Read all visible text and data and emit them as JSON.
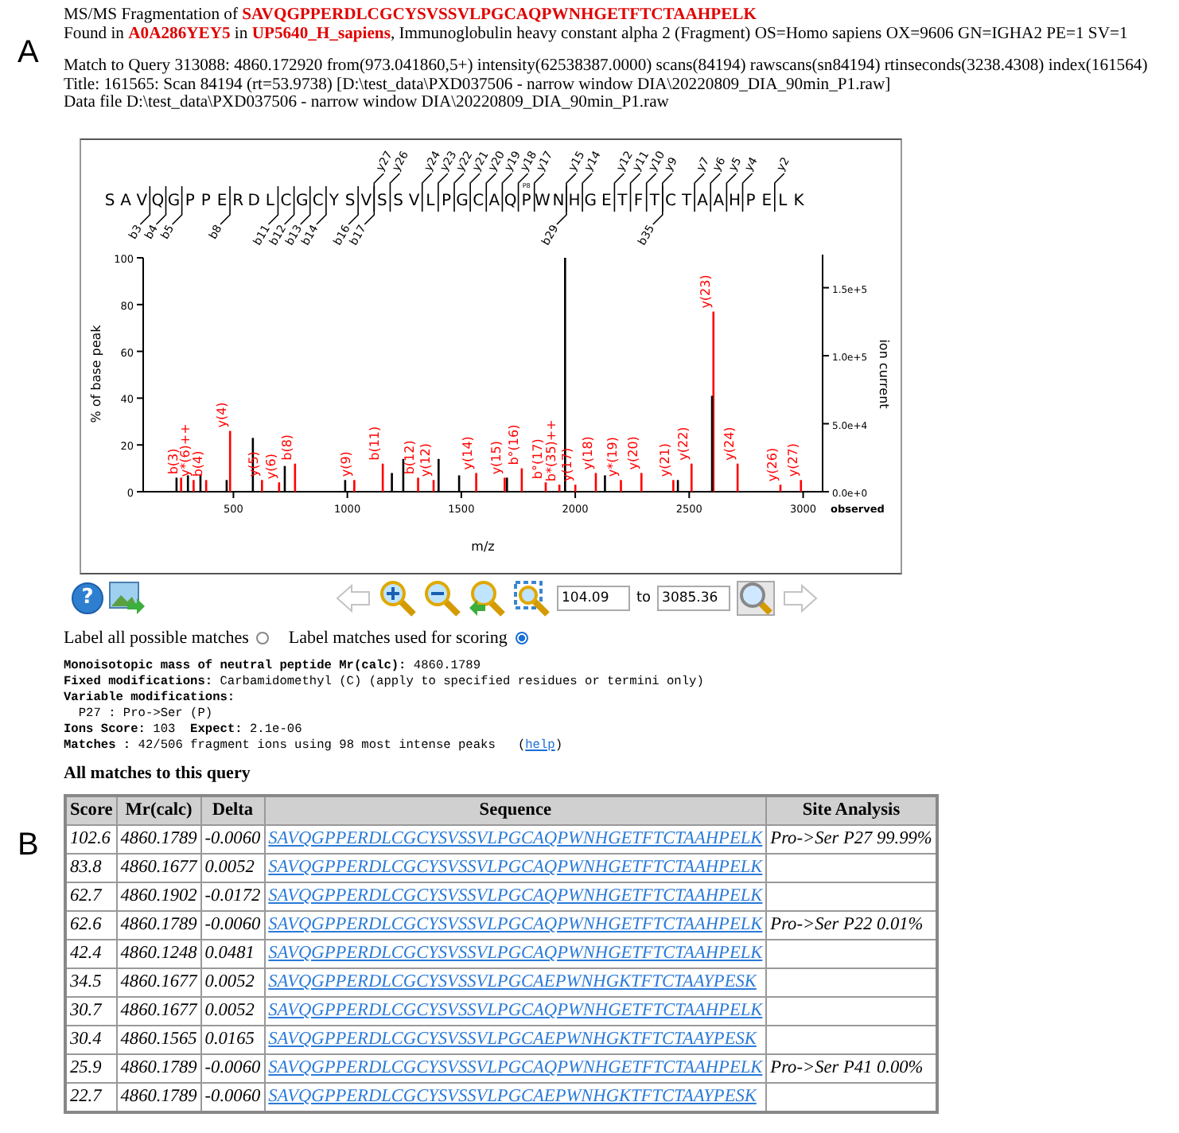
{
  "panels": {
    "top": "A",
    "bottom": "B"
  },
  "title_lines": [
    "MS/MS Fragmentation of **SAVQGPPERDLCGCYSVSSVLPGCAQPWNHGETFTCTAAHPELK**",
    "Found in **A0A286YEY5** in **UP5640_H_sapiens**, Immunoglobulin heavy constant alpha 2 (Fragment) OS=Homo sapiens OX=9606 GN=IGHA2 PE=1 SV=1"
  ],
  "query_lines": [
    "Match to Query 313088: 4860.172920 from(973.041860,5+) intensity(62538387.0000) scans(84194) rawscans(sn84194) rtinseconds(3238.4308) index(161564)",
    "Title: 161565: Scan 84194 (rt=53.9738) [D:\\test_data\\PXD037506 - narrow window DIA\\20220809_DIA_90min_P1.raw]",
    "Data file D:\\test_data\\PXD037506 - narrow window DIA\\20220809_DIA_90min_P1.raw"
  ],
  "ladder": [
    {
      "aa": "S"
    },
    {
      "aa": "A"
    },
    {
      "aa": "V",
      "b": "b3"
    },
    {
      "aa": "Q",
      "b": "b4"
    },
    {
      "aa": "G",
      "b": "b5"
    },
    {
      "aa": "P"
    },
    {
      "aa": "P"
    },
    {
      "aa": "E",
      "b": "b8"
    },
    {
      "aa": "R"
    },
    {
      "aa": "D"
    },
    {
      "aa": "L",
      "b": "b11"
    },
    {
      "aa": "C",
      "b": "b12"
    },
    {
      "aa": "G",
      "b": "b13"
    },
    {
      "aa": "C",
      "b": "b14"
    },
    {
      "aa": "Y"
    },
    {
      "aa": "S",
      "b": "b16"
    },
    {
      "aa": "V",
      "b": "b17",
      "y": "y27"
    },
    {
      "aa": "S",
      "y": "y26"
    },
    {
      "aa": "S"
    },
    {
      "aa": "V",
      "y": "y24"
    },
    {
      "aa": "L",
      "y": "y23"
    },
    {
      "aa": "P",
      "y": "y22"
    },
    {
      "aa": "G",
      "y": "y21"
    },
    {
      "aa": "C",
      "y": "y20"
    },
    {
      "aa": "A",
      "y": "y19"
    },
    {
      "aa": "Q",
      "y": "y18"
    },
    {
      "aa": "P",
      "y": "y17",
      "mod": "P8"
    },
    {
      "aa": "W"
    },
    {
      "aa": "N",
      "b": "b29",
      "y": "y15"
    },
    {
      "aa": "H",
      "y": "y14"
    },
    {
      "aa": "G"
    },
    {
      "aa": "E",
      "y": "y12"
    },
    {
      "aa": "T",
      "y": "y11"
    },
    {
      "aa": "F",
      "y": "y10"
    },
    {
      "aa": "T",
      "b": "b35",
      "y": "y9"
    },
    {
      "aa": "C"
    },
    {
      "aa": "T",
      "y": "y7"
    },
    {
      "aa": "A",
      "y": "y6"
    },
    {
      "aa": "A",
      "y": "y5"
    },
    {
      "aa": "H",
      "y": "y4"
    },
    {
      "aa": "P"
    },
    {
      "aa": "E",
      "y": "y2"
    },
    {
      "aa": "L"
    },
    {
      "aa": "K"
    }
  ],
  "chart_data": {
    "type": "bar",
    "xlabel": "m/z",
    "ylabel": "% of base peak",
    "xlim": [
      104.09,
      3085.36
    ],
    "ylim": [
      0,
      100
    ],
    "xticks": [
      500,
      1000,
      1500,
      2000,
      2500,
      3000
    ],
    "yticks": [
      0,
      20,
      40,
      60,
      80,
      100
    ],
    "y2label": "ion current",
    "y2lim": [
      0,
      172000
    ],
    "y2ticks": [
      {
        "value": 0,
        "label": "0.0e+0"
      },
      {
        "value": 50000,
        "label": "5.0e+4"
      },
      {
        "value": 100000,
        "label": "1.0e+5"
      },
      {
        "value": 150000,
        "label": "1.5e+5"
      }
    ],
    "x": [
      250,
      270,
      300,
      325,
      355,
      380,
      470,
      485,
      585,
      625,
      700,
      725,
      770,
      990,
      1030,
      1155,
      1195,
      1245,
      1310,
      1378,
      1400,
      1490,
      1565,
      1690,
      1700,
      1765,
      1870,
      1930,
      1955,
      2000,
      2090,
      2130,
      2200,
      2290,
      2430,
      2450,
      2510,
      2600,
      2606,
      2712,
      2900,
      2990
    ],
    "series": [
      {
        "color": "#ff0000",
        "values": [
          null,
          6,
          null,
          5,
          null,
          5,
          null,
          26,
          null,
          5,
          4,
          null,
          12,
          null,
          5,
          12,
          null,
          null,
          6,
          5,
          null,
          null,
          8,
          6,
          null,
          10,
          4,
          3,
          null,
          3,
          8,
          null,
          5,
          8,
          5,
          null,
          12,
          null,
          77,
          12,
          3,
          5
        ]
      },
      {
        "color": "#000000",
        "values": [
          6,
          null,
          7,
          null,
          7,
          null,
          5,
          null,
          23,
          null,
          null,
          11,
          null,
          5,
          null,
          null,
          8,
          14,
          null,
          null,
          14,
          7,
          null,
          null,
          6,
          null,
          null,
          null,
          100,
          null,
          null,
          7,
          null,
          null,
          null,
          5,
          null,
          41,
          null,
          null,
          null,
          null
        ]
      }
    ],
    "annotations": [
      {
        "x": 270,
        "y": 6,
        "text": "b(3)"
      },
      {
        "x": 325,
        "y": 5,
        "text": "y*(6)++"
      },
      {
        "x": 380,
        "y": 5,
        "text": "b(4)"
      },
      {
        "x": 485,
        "y": 26,
        "text": "y(4)"
      },
      {
        "x": 625,
        "y": 5,
        "text": "y(5)"
      },
      {
        "x": 700,
        "y": 4,
        "text": "y(6)"
      },
      {
        "x": 770,
        "y": 12,
        "text": "b(8)"
      },
      {
        "x": 1030,
        "y": 5,
        "text": "y(9)"
      },
      {
        "x": 1155,
        "y": 12,
        "text": "b(11)"
      },
      {
        "x": 1310,
        "y": 6,
        "text": "b(12)"
      },
      {
        "x": 1378,
        "y": 5,
        "text": "y(12)"
      },
      {
        "x": 1565,
        "y": 8,
        "text": "y(14)"
      },
      {
        "x": 1690,
        "y": 6,
        "text": "y(15)"
      },
      {
        "x": 1765,
        "y": 10,
        "text": "b°(16)"
      },
      {
        "x": 1870,
        "y": 4,
        "text": "b°(17)"
      },
      {
        "x": 1930,
        "y": 3,
        "text": "b*(35)++"
      },
      {
        "x": 2000,
        "y": 3,
        "text": "y(17)"
      },
      {
        "x": 2090,
        "y": 8,
        "text": "y(18)"
      },
      {
        "x": 2200,
        "y": 5,
        "text": "y*(19)"
      },
      {
        "x": 2290,
        "y": 8,
        "text": "y(20)"
      },
      {
        "x": 2430,
        "y": 5,
        "text": "y(21)"
      },
      {
        "x": 2510,
        "y": 12,
        "text": "y(22)"
      },
      {
        "x": 2606,
        "y": 77,
        "text": "y(23)"
      },
      {
        "x": 2712,
        "y": 12,
        "text": "y(24)"
      },
      {
        "x": 2900,
        "y": 3,
        "text": "y(26)"
      },
      {
        "x": 2990,
        "y": 5,
        "text": "y(27)"
      }
    ]
  },
  "chart_caption": "observed",
  "toolbar": {
    "help_glyph": "?",
    "back_disabled": true,
    "forward_disabled": true,
    "from_value": "104.09",
    "to_label": "to",
    "to_value": "3085.36"
  },
  "radios": [
    {
      "label": "Label all possible matches",
      "selected": false
    },
    {
      "label": "Label matches used for scoring",
      "selected": true
    }
  ],
  "summary": [
    {
      "kind": "entry",
      "text": "**Monoisotopic mass of neutral peptide Mr(calc):** 4860.1789"
    },
    {
      "kind": "entry",
      "text": "**Fixed modifications:** Carbamidomethyl (C) (apply to specified residues or termini only)"
    },
    {
      "kind": "heading",
      "text": "Variable modifications:"
    },
    {
      "kind": "entry",
      "text": "  P27 : Pro->Ser (P)"
    },
    {
      "kind": "entry",
      "text": "**Ions Score:** 103  **Expect:** 2.1e-06"
    }
  ],
  "matches": {
    "text": "**Matches :** 42/506 fragment ions using 98 most intense peaks   ",
    "open": "(",
    "link": "help",
    "close": ")"
  },
  "matches_heading": "All matches to this query",
  "table": {
    "columns": [
      "Score",
      "Mr(calc)",
      "Delta",
      "Sequence",
      "Site Analysis"
    ],
    "rows": [
      {
        "score": "102.6",
        "mr": "4860.1789",
        "delta": "-0.0060",
        "sequence": "SAVQGPPERDLCGCYSVSSVLPGCAQPWNHGETFTCTAAHPELK",
        "site": "Pro->Ser P27 99.99%"
      },
      {
        "score": "83.8",
        "mr": "4860.1677",
        "delta": "0.0052",
        "sequence": "SAVQGPPERDLCGCYSVSSVLPGCAQPWNHGETFTCTAAHPELK"
      },
      {
        "score": "62.7",
        "mr": "4860.1902",
        "delta": "-0.0172",
        "sequence": "SAVQGPPERDLCGCYSVSSVLPGCAQPWNHGETFTCTAAHPELK"
      },
      {
        "score": "62.6",
        "mr": "4860.1789",
        "delta": "-0.0060",
        "sequence": "SAVQGPPERDLCGCYSVSSVLPGCAQPWNHGETFTCTAAHPELK",
        "site": "Pro->Ser P22 0.01%"
      },
      {
        "score": "42.4",
        "mr": "4860.1248",
        "delta": "0.0481",
        "sequence": "SAVQGPPERDLCGCYSVSSVLPGCAQPWNHGETFTCTAAHPELK"
      },
      {
        "score": "34.5",
        "mr": "4860.1677",
        "delta": "0.0052",
        "sequence": "SAVQGPPERDLCGCYSVSSVLPGCAEPWNHGKTFTCTAAYPESK"
      },
      {
        "score": "30.7",
        "mr": "4860.1677",
        "delta": "0.0052",
        "sequence": "SAVQGPPERDLCGCYSVSSVLPGCAQPWNHGETFTCTAAHPELK"
      },
      {
        "score": "30.4",
        "mr": "4860.1565",
        "delta": "0.0165",
        "sequence": "SAVQGPPERDLCGCYSVSSVLPGCAEPWNHGKTFTCTAAYPESK"
      },
      {
        "score": "25.9",
        "mr": "4860.1789",
        "delta": "-0.0060",
        "sequence": "SAVQGPPERDLCGCYSVSSVLPGCAQPWNHGETFTCTAAHPELK",
        "site": "Pro->Ser P41 0.00%"
      },
      {
        "score": "22.7",
        "mr": "4860.1789",
        "delta": "-0.0060",
        "sequence": "SAVQGPPERDLCGCYSVSSVLPGCAEPWNHGKTFTCTAAYPESK"
      }
    ]
  }
}
